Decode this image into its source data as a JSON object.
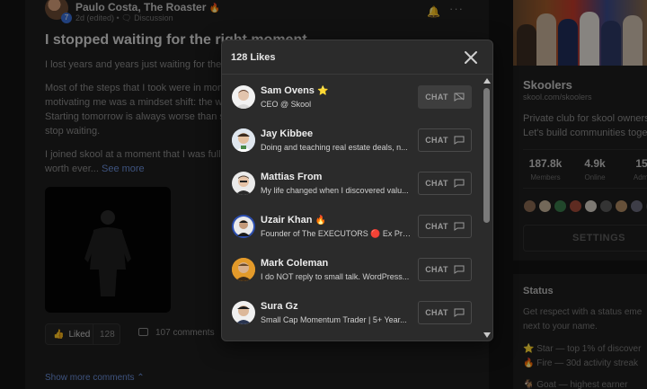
{
  "post": {
    "author": "Paulo Costa, The Roaster",
    "author_suffix_icon": "fire-icon",
    "level": "7",
    "meta": "2d (edited) • 🗨 Discussion",
    "title": "I stopped waiting for the right moment",
    "p1": "I lost years and years just waiting for the",
    "p2": "Most of the steps that I took were in mom motivating me was a mindset shift: the w Starting tomorrow is always worse than s stop waiting.",
    "p3_text": "I joined skool at a moment that I was full was worth ever... ",
    "p3_link": "See more",
    "liked_label": "Liked",
    "like_count": "128",
    "comments_label": "107 comments",
    "show_more": "Show more comments"
  },
  "sidebar": {
    "group_name": "Skoolers",
    "group_url": "skool.com/skoolers",
    "desc_line1": "Private club for skool owners",
    "desc_line2": "Let's build communities toget",
    "stats": [
      {
        "value": "187.8k",
        "label": "Members"
      },
      {
        "value": "4.9k",
        "label": "Online"
      },
      {
        "value": "15",
        "label": "Admi"
      }
    ],
    "settings_label": "SETTINGS"
  },
  "status": {
    "title": "Status",
    "desc_line1": "Get respect with a status eme",
    "desc_line2": "next to your name.",
    "star_line": "Star — top 1% of discover",
    "fire_line": "Fire — 30d activity streak",
    "goat_line": "Goat — highest earner"
  },
  "modal": {
    "title": "128 Likes",
    "chat_label": "CHAT",
    "users": [
      {
        "name": "Sam Ovens",
        "badge": "⭐",
        "bio": "CEO @ Skool"
      },
      {
        "name": "Jay Kibbee",
        "badge": "",
        "bio": "Doing and teaching real estate deals, n..."
      },
      {
        "name": "Mattias From",
        "badge": "",
        "bio": "My life changed when I discovered valu..."
      },
      {
        "name": "Uzair Khan",
        "badge": "🔥",
        "bio": "Founder of The EXECUTORS 🔴 Ex Pro..."
      },
      {
        "name": "Mark Coleman",
        "badge": "",
        "bio": "I do NOT reply to small talk. WordPress..."
      },
      {
        "name": "Sura Gz",
        "badge": "",
        "bio": "Small Cap Momentum Trader | 5+ Year..."
      }
    ]
  },
  "colors": {
    "background": "#141414",
    "card": "#1e1e1e",
    "modal": "#2b2b2b",
    "link": "#6a8ed8",
    "star": "#f2b01e",
    "fire": "#f07a1a"
  }
}
